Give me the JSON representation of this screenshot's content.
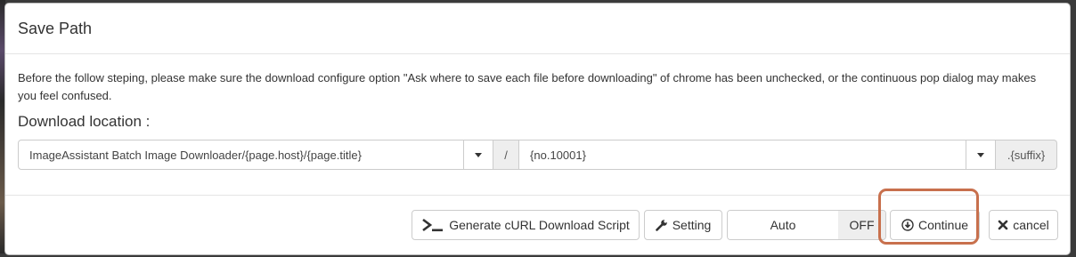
{
  "dialog": {
    "title": "Save Path",
    "notice": "Before the follow steping, please make sure the download configure option \"Ask where to save each file before downloading\" of chrome has been unchecked, or the continuous pop dialog may makes you feel confused.",
    "location_label": "Download location :",
    "path_folder": "ImageAssistant Batch Image Downloader/{page.host}/{page.title}",
    "separator": "/",
    "path_filename": "{no.10001}",
    "suffix": ".{suffix}"
  },
  "footer": {
    "curl_label": "Generate cURL Download Script",
    "setting_label": "Setting",
    "auto_label": "Auto",
    "auto_state": "OFF",
    "continue_label": "Continue",
    "cancel_label": "cancel"
  },
  "icons": {
    "curl": "terminal-icon",
    "setting": "wrench-icon",
    "continue": "download-circle-icon",
    "cancel": "close-icon"
  },
  "colors": {
    "highlight": "#c8704d"
  }
}
